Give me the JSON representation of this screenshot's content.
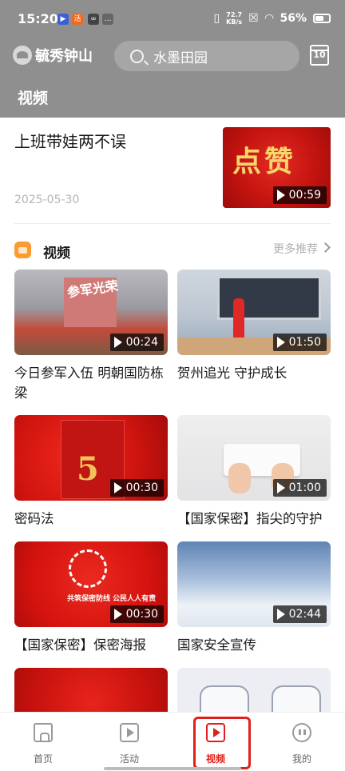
{
  "status_bar": {
    "time": "15:20",
    "speed_value": "72.7",
    "speed_unit": "KB/s",
    "battery": "56%"
  },
  "header": {
    "logo_text": "毓秀钟山",
    "search_value": "水墨田园",
    "calendar_day": "10",
    "page_title": "视频"
  },
  "feature": {
    "title": "上班带娃两不误",
    "date": "2025-05-30",
    "thumb_text": "点赞",
    "duration": "00:59"
  },
  "section": {
    "title": "视频",
    "more_label": "更多推荐"
  },
  "videos": [
    {
      "title": "今日参军入伍 明朝国防栋梁",
      "duration": "00:24",
      "thumb_text": "参军光荣"
    },
    {
      "title": "贺州追光 守护成长",
      "duration": "01:50"
    },
    {
      "title": "密码法",
      "duration": "00:30"
    },
    {
      "title": "【国家保密】指尖的守护",
      "duration": "01:00"
    },
    {
      "title": "【国家保密】保密海报",
      "duration": "00:30",
      "thumb_text": "共筑保密防线 公民人人有责"
    },
    {
      "title": "国家安全宣传",
      "duration": "02:44"
    },
    {
      "title": "",
      "duration": ""
    },
    {
      "title": "",
      "duration": ""
    }
  ],
  "bottom_nav": {
    "items": [
      {
        "label": "首页",
        "icon": "home-icon"
      },
      {
        "label": "活动",
        "icon": "play-square-icon"
      },
      {
        "label": "视频",
        "icon": "video-icon",
        "active": true
      },
      {
        "label": "我的",
        "icon": "face-icon"
      }
    ]
  },
  "colors": {
    "accent": "#e0201b",
    "header_bg": "#8f8f8f"
  }
}
